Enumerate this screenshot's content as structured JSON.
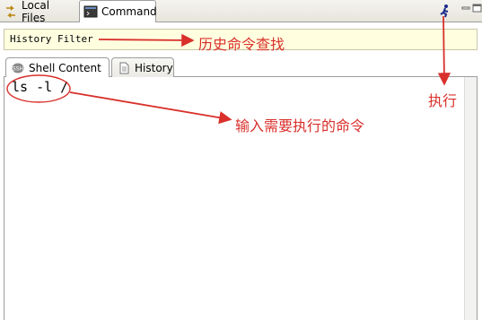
{
  "tabs": [
    {
      "label": "Local Files",
      "icon": "local-files-icon"
    },
    {
      "label": "Command",
      "icon": "terminal-icon"
    }
  ],
  "toolbar": {
    "run_icon": "run-person-icon"
  },
  "filter": {
    "label": "History Filter"
  },
  "inner_tabs": [
    {
      "label": "Shell Content",
      "icon": "ssh-icon"
    },
    {
      "label": "History",
      "icon": "document-icon"
    }
  ],
  "editor": {
    "command": "ls -l /"
  },
  "annotations": {
    "history_search": "历史命令查找",
    "run": "执行",
    "input_hint": "输入需要执行的命令"
  },
  "colors": {
    "annotation": "#d9302b",
    "filter_bg": "#ffffe0"
  }
}
